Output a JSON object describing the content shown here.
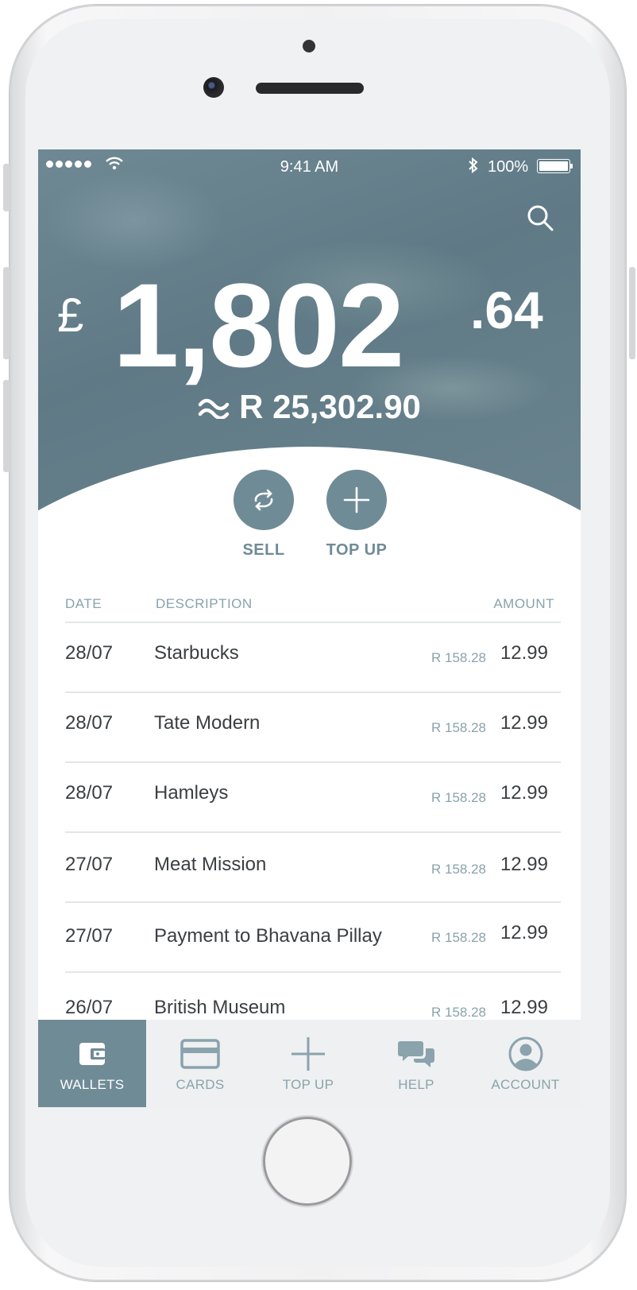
{
  "status_bar": {
    "time": "9:41 AM",
    "battery_percent": "100%"
  },
  "balance": {
    "currency_symbol": "£",
    "whole": "1,802",
    "decimal": ".64",
    "converted": "R 25,302.90"
  },
  "actions": [
    {
      "label": "SELL",
      "icon": "exchange-icon"
    },
    {
      "label": "TOP UP",
      "icon": "plus-icon"
    }
  ],
  "table": {
    "headers": {
      "date": "DATE",
      "description": "DESCRIPTION",
      "amount": "AMOUNT"
    },
    "rows": [
      {
        "date": "28/07",
        "description": "Starbucks",
        "rand": "R 158.28",
        "amount": "12.99"
      },
      {
        "date": "28/07",
        "description": "Tate Modern",
        "rand": "R 158.28",
        "amount": "12.99"
      },
      {
        "date": "28/07",
        "description": "Hamleys",
        "rand": "R 158.28",
        "amount": "12.99"
      },
      {
        "date": "27/07",
        "description": "Meat Mission",
        "rand": "R 158.28",
        "amount": "12.99"
      },
      {
        "date": "27/07",
        "description": "Payment to Bhavana Pillay",
        "rand": "R 158.28",
        "amount": "12.99"
      },
      {
        "date": "26/07",
        "description": "British Museum",
        "rand": "R 158.28",
        "amount": "12.99"
      }
    ]
  },
  "tabbar": [
    {
      "label": "WALLETS",
      "icon": "wallet-icon",
      "active": true
    },
    {
      "label": "CARDS",
      "icon": "card-icon",
      "active": false
    },
    {
      "label": "TOP UP",
      "icon": "plus-icon",
      "active": false
    },
    {
      "label": "HELP",
      "icon": "chat-bubbles-icon",
      "active": false
    },
    {
      "label": "ACCOUNT",
      "icon": "user-icon",
      "active": false
    }
  ],
  "colors": {
    "accent": "#6f8b96",
    "muted": "#8aa3ac",
    "text": "#3b3f42"
  }
}
